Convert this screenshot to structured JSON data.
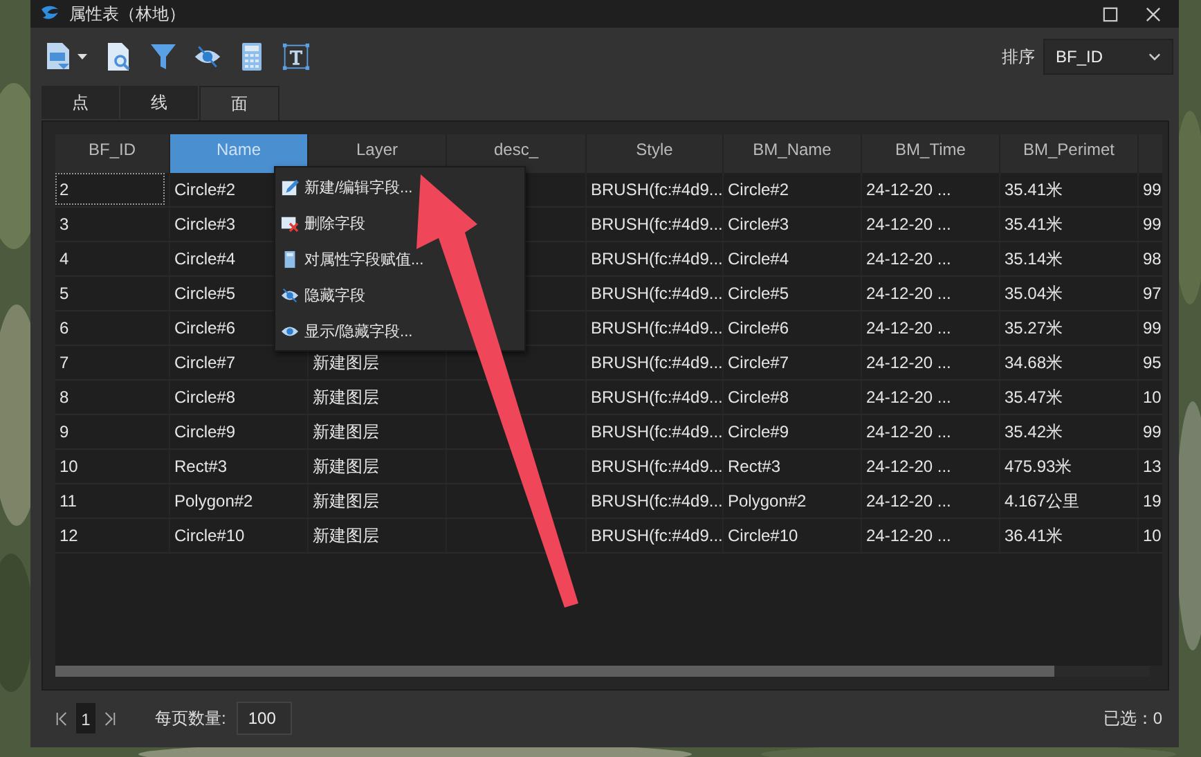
{
  "window": {
    "title": "属性表（林地）"
  },
  "toolbar": {
    "buttons": [
      {
        "kind": "export"
      },
      {
        "kind": "preview"
      },
      {
        "kind": "filter"
      },
      {
        "kind": "hide"
      },
      {
        "kind": "calculator"
      },
      {
        "kind": "text"
      }
    ],
    "sort_label": "排序",
    "sort_value": "BF_ID"
  },
  "tabs": [
    {
      "label": "点",
      "selected": false
    },
    {
      "label": "线",
      "selected": false
    },
    {
      "label": "面",
      "selected": true
    }
  ],
  "table": {
    "columns": [
      {
        "label": "BF_ID",
        "selected": false
      },
      {
        "label": "Name",
        "selected": true
      },
      {
        "label": "Layer",
        "selected": false
      },
      {
        "label": "desc_",
        "selected": false
      },
      {
        "label": "Style",
        "selected": false
      },
      {
        "label": "BM_Name",
        "selected": false
      },
      {
        "label": "BM_Time",
        "selected": false
      },
      {
        "label": "BM_Perimet",
        "selected": false
      }
    ],
    "rows": [
      {
        "current": true,
        "cells": [
          "2",
          "Circle#2",
          null,
          null,
          "BRUSH(fc:#4d9...",
          "Circle#2",
          "24-12-20 ...",
          "35.41米",
          "99"
        ]
      },
      {
        "current": false,
        "cells": [
          "3",
          "Circle#3",
          null,
          null,
          "BRUSH(fc:#4d9...",
          "Circle#3",
          "24-12-20 ...",
          "35.41米",
          "99"
        ]
      },
      {
        "current": false,
        "cells": [
          "4",
          "Circle#4",
          null,
          null,
          "BRUSH(fc:#4d9...",
          "Circle#4",
          "24-12-20 ...",
          "35.14米",
          "98"
        ]
      },
      {
        "current": false,
        "cells": [
          "5",
          "Circle#5",
          null,
          null,
          "BRUSH(fc:#4d9...",
          "Circle#5",
          "24-12-20 ...",
          "35.04米",
          "97"
        ]
      },
      {
        "current": false,
        "cells": [
          "6",
          "Circle#6",
          null,
          null,
          "BRUSH(fc:#4d9...",
          "Circle#6",
          "24-12-20 ...",
          "35.27米",
          "99"
        ]
      },
      {
        "current": false,
        "cells": [
          "7",
          "Circle#7",
          "新建图层",
          null,
          "BRUSH(fc:#4d9...",
          "Circle#7",
          "24-12-20 ...",
          "34.68米",
          "95"
        ]
      },
      {
        "current": false,
        "cells": [
          "8",
          "Circle#8",
          "新建图层",
          null,
          "BRUSH(fc:#4d9...",
          "Circle#8",
          "24-12-20 ...",
          "35.47米",
          "10"
        ]
      },
      {
        "current": false,
        "cells": [
          "9",
          "Circle#9",
          "新建图层",
          null,
          "BRUSH(fc:#4d9...",
          "Circle#9",
          "24-12-20 ...",
          "35.42米",
          "99"
        ]
      },
      {
        "current": false,
        "cells": [
          "10",
          "Rect#3",
          "新建图层",
          null,
          "BRUSH(fc:#4d9...",
          "Rect#3",
          "24-12-20 ...",
          "475.93米",
          "13"
        ]
      },
      {
        "current": false,
        "cells": [
          "11",
          "Polygon#2",
          "新建图层",
          null,
          "BRUSH(fc:#4d9...",
          "Polygon#2",
          "24-12-20 ...",
          "4.167公里",
          "19"
        ]
      },
      {
        "current": false,
        "cells": [
          "12",
          "Circle#10",
          "新建图层",
          null,
          "BRUSH(fc:#4d9...",
          "Circle#10",
          "24-12-20 ...",
          "36.41米",
          "10"
        ]
      }
    ]
  },
  "context_menu": {
    "items": [
      {
        "kind": "edit",
        "label": "新建/编辑字段..."
      },
      {
        "kind": "delete",
        "label": "删除字段"
      },
      {
        "kind": "calculator",
        "label": "对属性字段赋值..."
      },
      {
        "kind": "hide",
        "label": "隐藏字段"
      },
      {
        "kind": "show",
        "label": "显示/隐藏字段..."
      }
    ]
  },
  "pager": {
    "page": "1",
    "page_size_label": "每页数量:",
    "page_size": "100",
    "selected_count": "已选：0"
  }
}
